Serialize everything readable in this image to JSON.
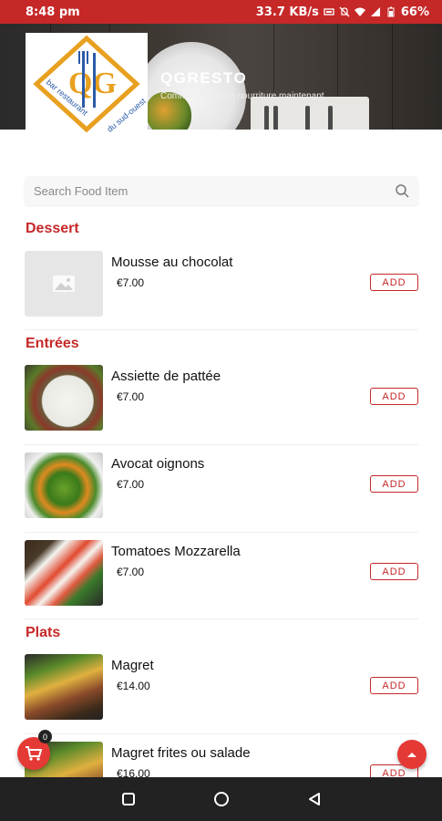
{
  "status_bar": {
    "time": "8:48 pm",
    "speed": "33.7 KB/s",
    "battery": "66%",
    "icons": [
      "data-saver-icon",
      "mute-icon",
      "wifi-icon",
      "signal-icon",
      "battery-icon"
    ]
  },
  "header": {
    "logo_text": "QG",
    "logo_caption_left": "bar restaurant",
    "logo_caption_right": "du sud-ouest",
    "brand": "QGRESTO",
    "tagline": "Commandez votre nourriture maintenant"
  },
  "search": {
    "placeholder": "Search Food Item",
    "icon": "search-icon"
  },
  "menu": {
    "add_label": "ADD",
    "sections": [
      {
        "title": "Dessert",
        "items": [
          {
            "name": "Mousse au chocolat",
            "price": "€7.00"
          }
        ]
      },
      {
        "title": "Entrées",
        "items": [
          {
            "name": "Assiette de pattée",
            "price": "€7.00"
          },
          {
            "name": "Avocat oignons",
            "price": "€7.00"
          },
          {
            "name": "Tomatoes Mozzarella",
            "price": "€7.00"
          }
        ]
      },
      {
        "title": "Plats",
        "items": [
          {
            "name": "Magret",
            "price": "€14.00"
          },
          {
            "name": "Magret frites ou salade",
            "price": "€16.00"
          }
        ]
      }
    ]
  },
  "cart": {
    "count": "0",
    "icon": "cart-icon"
  },
  "colors": {
    "accent": "#c62828",
    "fab": "#e53935",
    "nav": "#222222"
  }
}
